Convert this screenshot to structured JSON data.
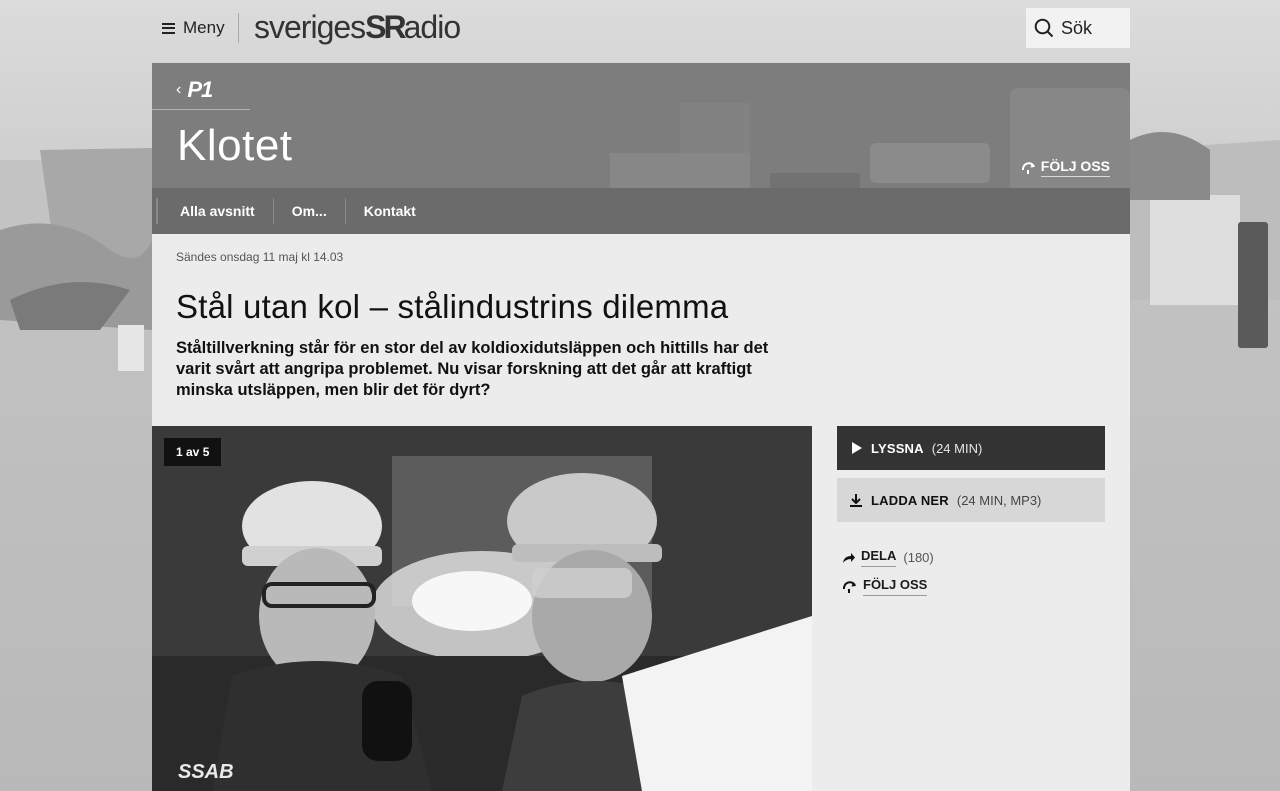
{
  "header": {
    "menu_label": "Meny",
    "logo_left": "sveriges",
    "logo_mark": "SR",
    "logo_right": "adio",
    "search_label": "Sök"
  },
  "program": {
    "back_label": "P1",
    "title": "Klotet",
    "follow_label": "FÖLJ OSS",
    "nav": [
      {
        "label": "Alla avsnitt"
      },
      {
        "label": "Om..."
      },
      {
        "label": "Kontakt"
      }
    ]
  },
  "episode": {
    "broadcast": "Sändes onsdag 11 maj kl 14.03",
    "title": "Stål utan kol – stålindustrins dilemma",
    "lead": "Ståltillverkning står för en stor del av koldioxidutsläppen och hittills har det varit svårt att angripa problemet. Nu visar forskning att det går att kraftigt minska utsläppen, men blir det för dyrt?",
    "image_counter": "1 av 5",
    "image_text": "SSAB",
    "listen_label": "LYSSNA",
    "listen_meta": "(24 MIN)",
    "download_label": "LADDA NER",
    "download_meta": "(24 MIN, MP3)",
    "share_label": "DELA",
    "share_count": "(180)",
    "follow_label": "FÖLJ OSS"
  }
}
